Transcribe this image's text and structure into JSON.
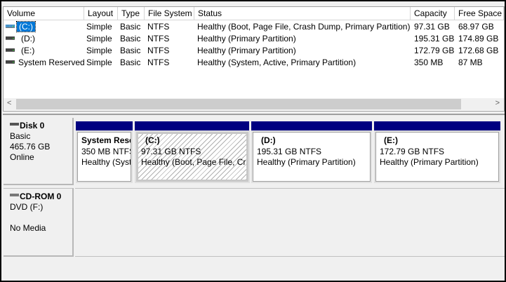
{
  "columns": [
    "Volume",
    "Layout",
    "Type",
    "File System",
    "Status",
    "Capacity",
    "Free Space"
  ],
  "volumes": [
    {
      "volume": "(C:)",
      "layout": "Simple",
      "type": "Basic",
      "fs": "NTFS",
      "status": "Healthy (Boot, Page File, Crash Dump, Primary Partition)",
      "capacity": "97.31 GB",
      "free": "68.97 GB",
      "selected": true
    },
    {
      "volume": "(D:)",
      "layout": "Simple",
      "type": "Basic",
      "fs": "NTFS",
      "status": "Healthy (Primary Partition)",
      "capacity": "195.31 GB",
      "free": "174.89 GB"
    },
    {
      "volume": "(E:)",
      "layout": "Simple",
      "type": "Basic",
      "fs": "NTFS",
      "status": "Healthy (Primary Partition)",
      "capacity": "172.79 GB",
      "free": "172.68 GB"
    },
    {
      "volume": "System Reserved",
      "layout": "Simple",
      "type": "Basic",
      "fs": "NTFS",
      "status": "Healthy (System, Active, Primary Partition)",
      "capacity": "350 MB",
      "free": "87 MB"
    }
  ],
  "scroll": {
    "left": "<",
    "right": ">"
  },
  "disk0": {
    "name": "Disk 0",
    "type": "Basic",
    "size": "465.76 GB",
    "state": "Online",
    "partitions": [
      {
        "name": "System Rese",
        "size": "350 MB NTFS",
        "status": "Healthy (Syst"
      },
      {
        "name": "(C:)",
        "size": "97.31 GB NTFS",
        "status": "Healthy (Boot, Page File, Cra"
      },
      {
        "name": "(D:)",
        "size": "195.31 GB NTFS",
        "status": "Healthy (Primary Partition)"
      },
      {
        "name": "(E:)",
        "size": "172.79 GB NTFS",
        "status": "Healthy (Primary Partition)"
      }
    ]
  },
  "cdrom0": {
    "name": "CD-ROM 0",
    "type": "DVD (F:)",
    "state": "No Media"
  },
  "colors": {
    "partition_bar": "#000080",
    "selection": "#0078d7"
  }
}
